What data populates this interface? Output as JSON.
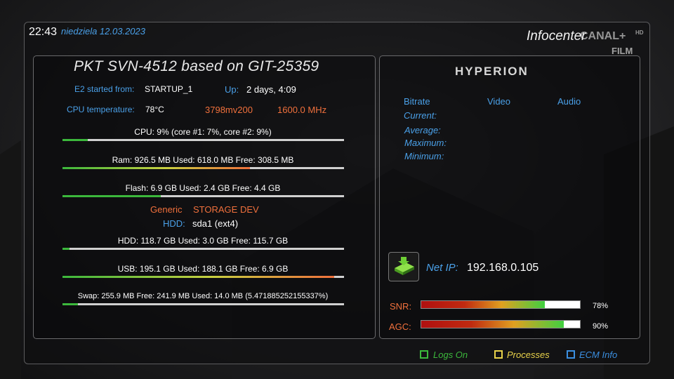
{
  "header": {
    "time": "22:43",
    "date": "niedziela 12.03.2023",
    "title": "Infocenter",
    "channel_logo": "CANAL+",
    "channel_hd": "HD",
    "channel_sub": "FILM"
  },
  "system": {
    "heading": "PKT SVN-4512  based on GIT-25359",
    "e2_started_label": "E2 started from:",
    "e2_started_value": "STARTUP_1",
    "uptime_label": "Up:",
    "uptime_value": "2 days,  4:09",
    "cpu_temp_label": "CPU temperature:",
    "cpu_temp_value": "78°C",
    "voltage": "3798mv200",
    "frequency": "1600.0 MHz",
    "cpu_line": "CPU:   9%   (core #1:   7%, core #2:   9%)",
    "cpu_usage": 0.09,
    "ram_line": "Ram: 926.5 MB Used: 618.0 MB Free: 308.5 MB",
    "ram_usage": 0.667,
    "flash_line": "Flash: 6.9 GB Used: 2.4 GB Free: 4.4 GB",
    "flash_usage": 0.35,
    "storage_generic": "Generic",
    "storage_dev": "STORAGE DEV",
    "hdd_label": "HDD:",
    "hdd_value": "sda1  (ext4)",
    "hdd_line": "HDD: 118.7 GB Used: 3.0 GB Free: 115.7 GB",
    "hdd_usage": 0.025,
    "usb_line": "USB: 195.1 GB Used: 188.1 GB Free: 6.9 GB",
    "usb_usage": 0.964,
    "swap_line": "Swap: 255.9 MB Free: 241.9 MB Used: 14.0 MB (5.471885252155337%)",
    "swap_usage": 0.0547
  },
  "stream": {
    "logo": "HYPERION",
    "bitrate_label": "Bitrate",
    "video_label": "Video",
    "audio_label": "Audio",
    "current_label": "Current:",
    "average_label": "Average:",
    "maximum_label": "Maximum:",
    "minimum_label": "Minimum:",
    "net_ip_label": "Net IP:",
    "net_ip_value": "192.168.0.105",
    "snr_label": "SNR:",
    "snr_value": "78%",
    "snr_level": 0.78,
    "agc_label": "AGC:",
    "agc_value": "90%",
    "agc_level": 0.9
  },
  "footer": {
    "logs": "Logs On",
    "processes": "Processes",
    "ecm": "ECM Info"
  },
  "colors": {
    "accent_blue": "#4aa0e8",
    "accent_orange": "#f0703c",
    "green": "#3cb83c",
    "yellow": "#e8d24a",
    "blue": "#3b8fe0"
  }
}
